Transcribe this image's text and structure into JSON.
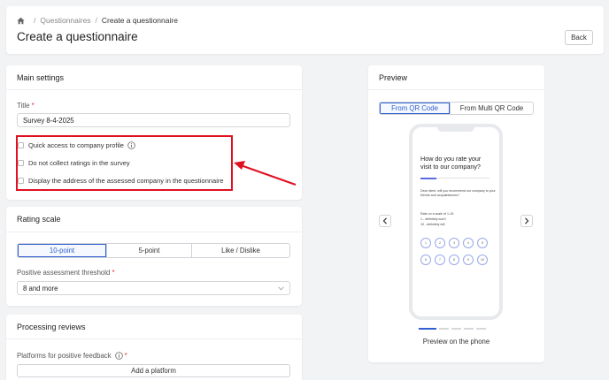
{
  "breadcrumb": {
    "parent": "Questionnaires",
    "current": "Create a questionnaire"
  },
  "header": {
    "title": "Create a questionnaire",
    "back_label": "Back"
  },
  "main_settings": {
    "title": "Main settings",
    "title_field_label": "Title",
    "title_field_required": "*",
    "title_value": "Survey 8-4-2025",
    "checkboxes": [
      {
        "label": "Quick access to company profile",
        "checked": false
      },
      {
        "label": "Do not collect ratings in the survey",
        "checked": false
      },
      {
        "label": "Display the address of the assessed company in the questionnaire",
        "checked": false
      }
    ]
  },
  "rating_scale": {
    "title": "Rating scale",
    "options": [
      "10-point",
      "5-point",
      "Like / Dislike"
    ],
    "selected": "10-point",
    "threshold_label": "Positive assessment threshold",
    "threshold_required": "*",
    "threshold_value": "8 and more"
  },
  "processing_reviews": {
    "title": "Processing reviews",
    "platforms_label": "Platforms for positive feedback",
    "platforms_required": "*",
    "add_button": "Add a platform"
  },
  "preview": {
    "title": "Preview",
    "tabs": [
      "From QR Code",
      "From Multi QR Code"
    ],
    "selected_tab": "From QR Code",
    "caption": "Preview on the phone",
    "phone": {
      "question": "How do you rate your visit to our company?",
      "intro": "Dear client, will you recommend our company to your friends and acquaintances?",
      "scale_title": "Rate on a scale of 1-10:",
      "scale_low": "1 - definitely won't",
      "scale_high": "10 - definitely will",
      "numbers": [
        "1",
        "2",
        "3",
        "4",
        "5",
        "6",
        "7",
        "8",
        "9",
        "10"
      ]
    }
  },
  "colors": {
    "accent": "#2f5fd0",
    "highlight": "#e01020",
    "required": "#e0303a"
  }
}
